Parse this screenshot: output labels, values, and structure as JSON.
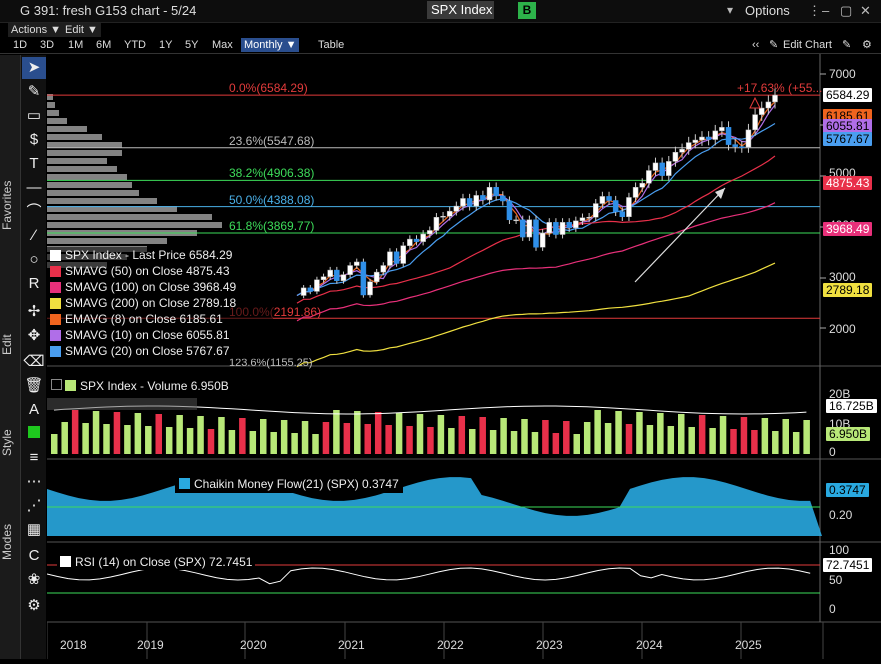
{
  "window": {
    "title": "G 391: fresh G153 chart - 5/24",
    "ticker": "SPX Index",
    "badge": "B",
    "options": "Options"
  },
  "menu": {
    "actions": "Actions ▼",
    "edit": "Edit ▼"
  },
  "ranges": [
    "1D",
    "3D",
    "1M",
    "6M",
    "YTD",
    "1Y",
    "5Y",
    "Max"
  ],
  "period": "Monthly ▼",
  "table_label": "Table",
  "edit_chart": "Edit Chart",
  "side_labels": {
    "favorites": "Favorites",
    "edit": "Edit",
    "style": "Style",
    "modes": "Modes"
  },
  "price_panel": {
    "y_ticks": [
      "7000",
      "6000",
      "5000",
      "4000",
      "3000",
      "2000"
    ],
    "fib_labels": [
      {
        "text": "0.0%(6584.29)",
        "color": "#e23b3b"
      },
      {
        "text": "23.6%(5547.68)",
        "color": "#bbbbbb"
      },
      {
        "text": "38.2%(4906.38)",
        "color": "#3ddc5a"
      },
      {
        "text": "50.0%(4388.08)",
        "color": "#4ab0e8"
      },
      {
        "text": "61.8%(3869.77)",
        "color": "#3ddc5a"
      },
      {
        "text": "100.0%(2191.86)",
        "color": "#e23b3b"
      },
      {
        "text": "123.6%(1155.25)",
        "color": "#bbbbbb"
      }
    ],
    "pct_note": "+17.63% (+55...",
    "tags": [
      {
        "text": "6584.29",
        "bg": "#ffffff",
        "fg": "#000000"
      },
      {
        "text": "6185.61",
        "bg": "#f0641e",
        "fg": "#000000"
      },
      {
        "text": "6055.81",
        "bg": "#b06ee8",
        "fg": "#000000"
      },
      {
        "text": "5767.67",
        "bg": "#4a9ef0",
        "fg": "#000000"
      },
      {
        "text": "4875.43",
        "bg": "#e8304a",
        "fg": "#ffffff"
      },
      {
        "text": "3968.49",
        "bg": "#e8307a",
        "fg": "#ffffff"
      },
      {
        "text": "2789.18",
        "bg": "#f0e040",
        "fg": "#000000"
      }
    ],
    "legend": [
      {
        "text": "SPX Index - Last Price 6584.29",
        "color": "#ffffff"
      },
      {
        "text": "SMAVG (50)  on Close 4875.43",
        "color": "#e8304a"
      },
      {
        "text": "SMAVG (100)  on Close 3968.49",
        "color": "#e8307a"
      },
      {
        "text": "SMAVG (200)  on Close 2789.18",
        "color": "#f0e040"
      },
      {
        "text": "EMAVG (8)  on Close 6185.61",
        "color": "#f0641e"
      },
      {
        "text": "SMAVG (10)  on Close 6055.81",
        "color": "#b06ee8"
      },
      {
        "text": "SMAVG (20)  on Close 5767.67",
        "color": "#4a9ef0"
      }
    ]
  },
  "volume_panel": {
    "legend": "SPX Index - Volume 6.950B",
    "y_ticks": [
      "20B",
      "10B",
      "0"
    ],
    "tags": [
      {
        "text": "16.725B",
        "bg": "#ffffff",
        "fg": "#000000"
      },
      {
        "text": "6.950B",
        "bg": "#b8e878",
        "fg": "#000000"
      }
    ]
  },
  "cmf_panel": {
    "legend": "Chaikin Money Flow(21) (SPX) 0.3747",
    "legend_color": "#29a9e0",
    "y_ticks": [
      "0.20"
    ],
    "tag": {
      "text": "0.3747",
      "bg": "#29a9e0",
      "fg": "#000000"
    }
  },
  "rsi_panel": {
    "legend": "RSI (14)  on Close (SPX) 72.7451",
    "y_ticks": [
      "100",
      "50",
      "0"
    ],
    "tag": {
      "text": "72.7451",
      "bg": "#ffffff",
      "fg": "#000000"
    }
  },
  "x_years": [
    "2018",
    "2019",
    "2020",
    "2021",
    "2022",
    "2023",
    "2024",
    "2025"
  ],
  "chart_data": {
    "type": "candlestick",
    "title": "SPX Index",
    "period": "Monthly",
    "ylim": [
      1500,
      7000
    ],
    "last_price": 6584.29,
    "moving_averages": [
      {
        "name": "SMAVG (50)",
        "value": 4875.43
      },
      {
        "name": "SMAVG (100)",
        "value": 3968.49
      },
      {
        "name": "SMAVG (200)",
        "value": 2789.18
      },
      {
        "name": "EMAVG (8)",
        "value": 6185.61
      },
      {
        "name": "SMAVG (10)",
        "value": 6055.81
      },
      {
        "name": "SMAVG (20)",
        "value": 5767.67
      }
    ],
    "fibonacci": [
      {
        "level": "0.0%",
        "value": 6584.29
      },
      {
        "level": "23.6%",
        "value": 5547.68
      },
      {
        "level": "38.2%",
        "value": 4906.38
      },
      {
        "level": "50.0%",
        "value": 4388.08
      },
      {
        "level": "61.8%",
        "value": 3869.77
      },
      {
        "level": "100.0%",
        "value": 2191.86
      },
      {
        "level": "123.6%",
        "value": 1155.25
      }
    ],
    "closes": [
      2640,
      2790,
      2720,
      2950,
      3010,
      3140,
      2930,
      3050,
      3230,
      3300,
      2650,
      2910,
      3100,
      3230,
      3500,
      3270,
      3620,
      3750,
      3700,
      3850,
      3920,
      4180,
      4200,
      4300,
      4400,
      4550,
      4400,
      4610,
      4520,
      4770,
      4600,
      4500,
      4130,
      4130,
      3790,
      4130,
      3590,
      3870,
      4080,
      3840,
      4080,
      3970,
      4110,
      4170,
      4180,
      4450,
      4590,
      4510,
      4290,
      4190,
      4570,
      4770,
      4850,
      5100,
      5250,
      5000,
      5280,
      5460,
      5520,
      5650,
      5700,
      5760,
      5710,
      5880,
      5950,
      5610,
      5570,
      5560,
      5900,
      6200,
      6330,
      6450,
      6584
    ]
  }
}
